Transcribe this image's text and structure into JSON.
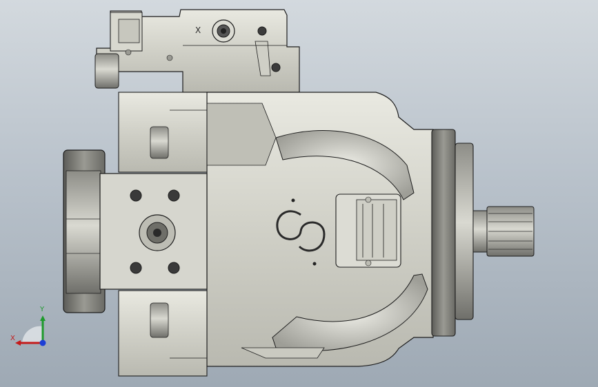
{
  "viewport": {
    "background_top": "#d3d9de",
    "background_bottom": "#9ea9b4"
  },
  "model": {
    "surface_colors": {
      "light": "#e6e6de",
      "mid": "#c8c8bf",
      "dark": "#7c7c76",
      "edge": "#1c1c1c"
    },
    "logo": "danfoss-style-emblem",
    "engraved_marker": "X"
  },
  "triad": {
    "x_label": "X",
    "y_label": "Y",
    "x_color": "#c41a1a",
    "y_color": "#1e9a2c",
    "z_color": "#1d3fd6"
  }
}
